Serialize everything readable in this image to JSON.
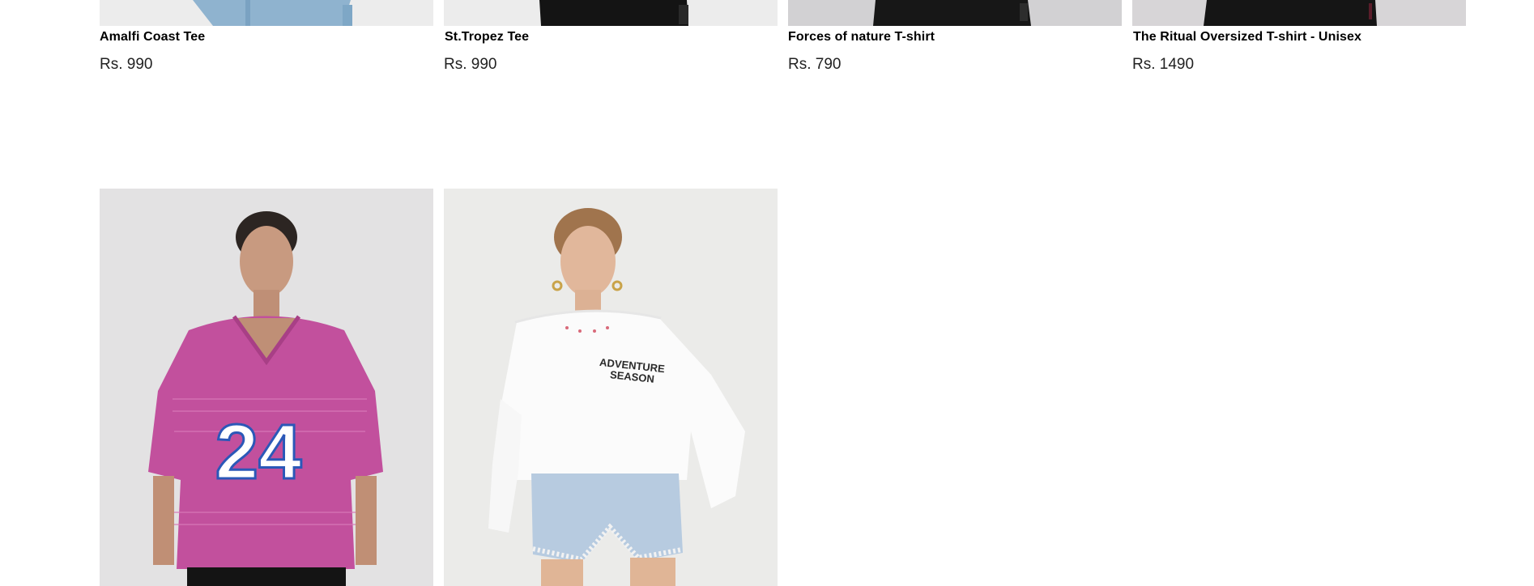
{
  "products_row1": [
    {
      "name": "Amalfi Coast Tee",
      "price": "Rs. 990"
    },
    {
      "name": "St.Tropez Tee",
      "price": "Rs. 990"
    },
    {
      "name": "Forces of nature T-shirt",
      "price": "Rs. 790"
    },
    {
      "name": "The Ritual Oversized T-shirt - Unisex",
      "price": "Rs. 1490"
    }
  ],
  "products_row2": [
    {
      "image_label": "pink knit v-neck jersey with number 24",
      "jersey_number": "24"
    },
    {
      "image_label": "white sweatshirt with Adventure Season print",
      "print_line1": "ADVENTURE",
      "print_line2": "SEASON"
    }
  ]
}
